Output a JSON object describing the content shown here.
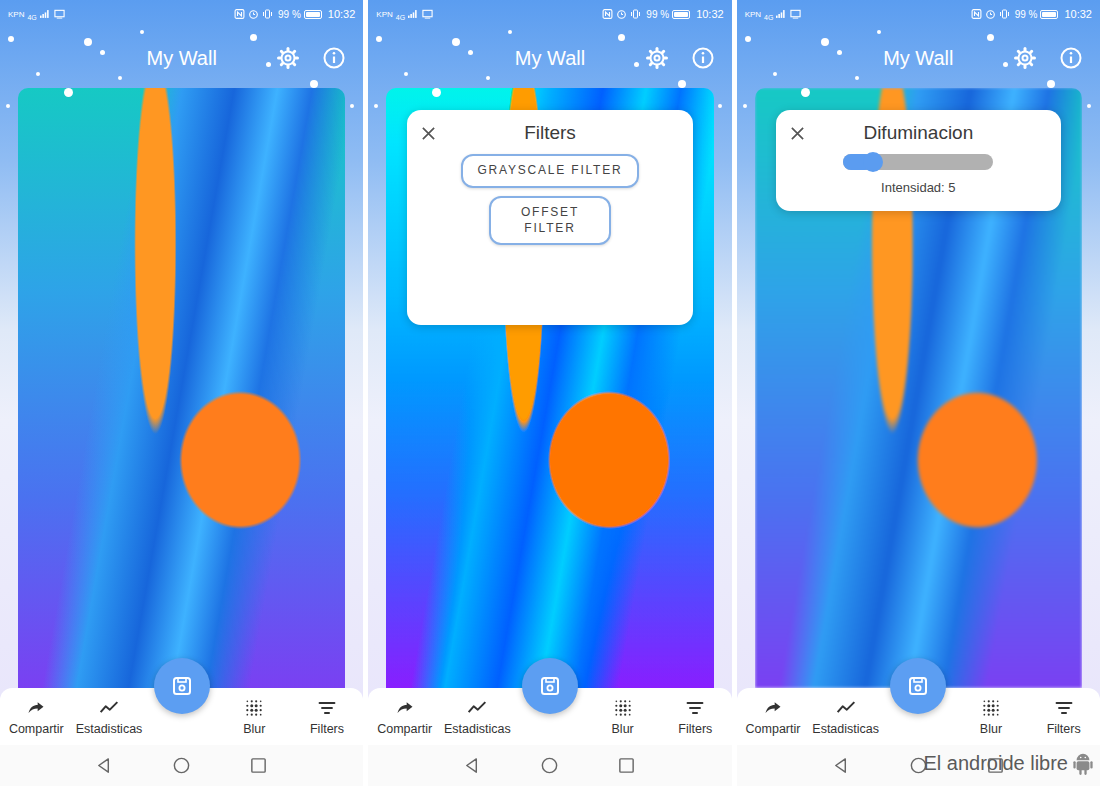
{
  "status_bar": {
    "carrier": "KPN",
    "network": "4G",
    "battery": "99 %",
    "battery_level": 0.99,
    "time": "10:32"
  },
  "app_bar": {
    "title": "My Wall"
  },
  "bottom_nav": [
    {
      "label": "Compartir"
    },
    {
      "label": "Estadisticas"
    },
    {
      "label": "Blur"
    },
    {
      "label": "Filters"
    }
  ],
  "screens": [
    {
      "wallpaper": {
        "effect": "none"
      }
    },
    {
      "wallpaper": {
        "effect": "offset"
      },
      "dialog": {
        "kind": "buttons",
        "title": "Filters",
        "options": [
          "GRAYSCALE FILTER",
          "OFFSET FILTER"
        ]
      }
    },
    {
      "wallpaper": {
        "effect": "blur"
      },
      "dialog": {
        "kind": "slider",
        "title": "Difuminacion",
        "level": 0.2,
        "reading": "Intensidad: 5"
      },
      "watermark": "El androide libre"
    }
  ]
}
